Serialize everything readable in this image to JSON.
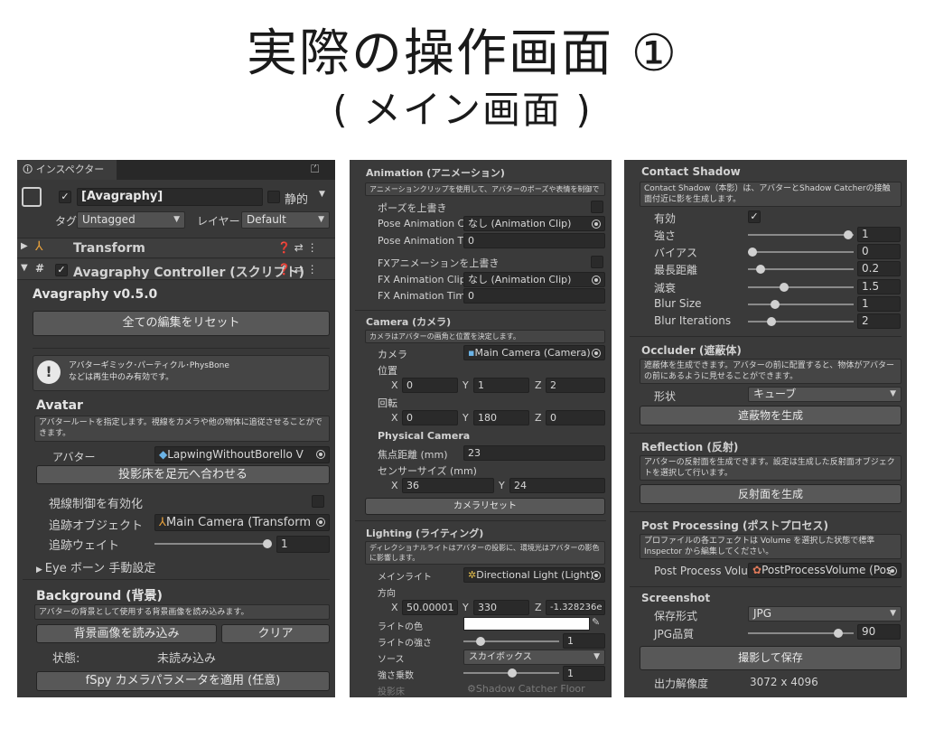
{
  "title": "実際の操作画面 ①",
  "subtitle": "( メイン画面 )",
  "p1": {
    "tab": "インスペクター",
    "object_name": "[Avagraphy]",
    "static_label": "静的",
    "tag_label": "タグ",
    "tag_value": "Untagged",
    "layer_label": "レイヤー",
    "layer_value": "Default",
    "transform": "Transform",
    "controller": "Avagraphy Controller (スクリプト)",
    "version": "Avagraphy v0.5.0",
    "reset_all": "全ての編集をリセット",
    "warn_text": "アバターギミック･パーティクル･PhysBone\nなどは再生中のみ有効です。",
    "avatar_hdr": "Avatar",
    "avatar_desc": "アバタールートを指定します。視線をカメラや他の物体に追従させることができます。",
    "avatar_label": "アバター",
    "avatar_value": "LapwingWithoutBorello V",
    "floor_btn": "投影床を足元へ合わせる",
    "gaze_label": "視線制御を有効化",
    "track_obj_label": "追跡オブジェクト",
    "track_obj_value": "Main Camera (Transform",
    "track_weight_label": "追跡ウェイト",
    "track_weight_value": "1",
    "eye_bone": "Eye ボーン 手動設定",
    "bg_hdr": "Background (背景)",
    "bg_desc": "アバターの背景として使用する背景画像を読み込みます。",
    "bg_load": "背景画像を読み込み",
    "bg_clear": "クリア",
    "state_label": "状態:",
    "state_value": "未読み込み",
    "fspy": "fSpy カメラパラメータを適用 (任意)"
  },
  "p2": {
    "anim_hdr": "Animation (アニメーション)",
    "anim_desc": "アニメーションクリップを使用して、アバターのポーズや表情を制御できます。",
    "pose_up": "ポーズを上書き",
    "pose_clip_label": "Pose Animation Cl",
    "pose_clip_value": "なし (Animation Clip)",
    "pose_time_label": "Pose Animation Ti",
    "pose_time_value": "0",
    "fx_up": "FXアニメーションを上書き",
    "fx_clip_label": "FX Animation Clip",
    "fx_clip_value": "なし (Animation Clip)",
    "fx_time_label": "FX Animation Tim",
    "fx_time_value": "0",
    "cam_hdr": "Camera (カメラ)",
    "cam_desc": "カメラはアバターの画角と位置を決定します。",
    "cam_label": "カメラ",
    "cam_value": "Main Camera (Camera)",
    "pos_label": "位置",
    "pos_x": "0",
    "pos_y": "1",
    "pos_z": "2",
    "rot_label": "回転",
    "rot_x": "0",
    "rot_y": "180",
    "rot_z": "0",
    "phys_hdr": "Physical Camera",
    "focal_label": "焦点距離 (mm)",
    "focal_value": "23",
    "sensor_label": "センサーサイズ (mm)",
    "sensor_x": "36",
    "sensor_y": "24",
    "cam_reset": "カメラリセット",
    "light_hdr": "Lighting (ライティング)",
    "light_desc": "ディレクショナルライトはアバターの投影に、環境光はアバターの影色に影響します。",
    "main_light_label": "メインライト",
    "main_light_value": "Directional Light (Light)",
    "dir_label": "方向",
    "dir_x": "50.00001",
    "dir_y": "330",
    "dir_z": "-1.328236e",
    "color_label": "ライトの色",
    "intensity_label": "ライトの強さ",
    "intensity_value": "1",
    "source_label": "ソース",
    "source_value": "スカイボックス",
    "mult_label": "強さ乗数",
    "mult_value": "1",
    "floor_label": "投影床",
    "floor_value": "Shadow Catcher Floor",
    "x": "X",
    "y": "Y",
    "z": "Z"
  },
  "p3": {
    "cs_hdr": "Contact Shadow",
    "cs_desc": "Contact Shadow（本影）は、アバターとShadow Catcherの接触面付近に影を生成します。",
    "enabled_label": "有効",
    "strength_label": "強さ",
    "strength_value": "1",
    "bias_label": "バイアス",
    "bias_value": "0",
    "maxdist_label": "最長距離",
    "maxdist_value": "0.2",
    "decay_label": "減衰",
    "decay_value": "1.5",
    "blur_label": "Blur Size",
    "blur_value": "1",
    "blur_it_label": "Blur Iterations",
    "blur_it_value": "2",
    "occ_hdr": "Occluder (遮蔽体)",
    "occ_desc": "遮蔽体を生成できます。アバターの前に配置すると、物体がアバターの前にあるように見せることができます。",
    "shape_label": "形状",
    "shape_value": "キューブ",
    "occ_btn": "遮蔽物を生成",
    "ref_hdr": "Reflection (反射)",
    "ref_desc": "アバターの反射面を生成できます。設定は生成した反射面オブジェクトを選択して行います。",
    "ref_btn": "反射面を生成",
    "pp_hdr": "Post Processing (ポストプロセス)",
    "pp_desc": "プロファイルの各エフェクトは Volume を選択した状態で標準 Inspector から編集してください。",
    "pp_label": "Post Process Volu",
    "pp_value": "PostProcessVolume (Pos",
    "ss_hdr": "Screenshot",
    "format_label": "保存形式",
    "format_value": "JPG",
    "quality_label": "JPG品質",
    "quality_value": "90",
    "save_btn": "撮影して保存",
    "res_label": "出力解像度",
    "res_value": "3072 x 4096"
  }
}
